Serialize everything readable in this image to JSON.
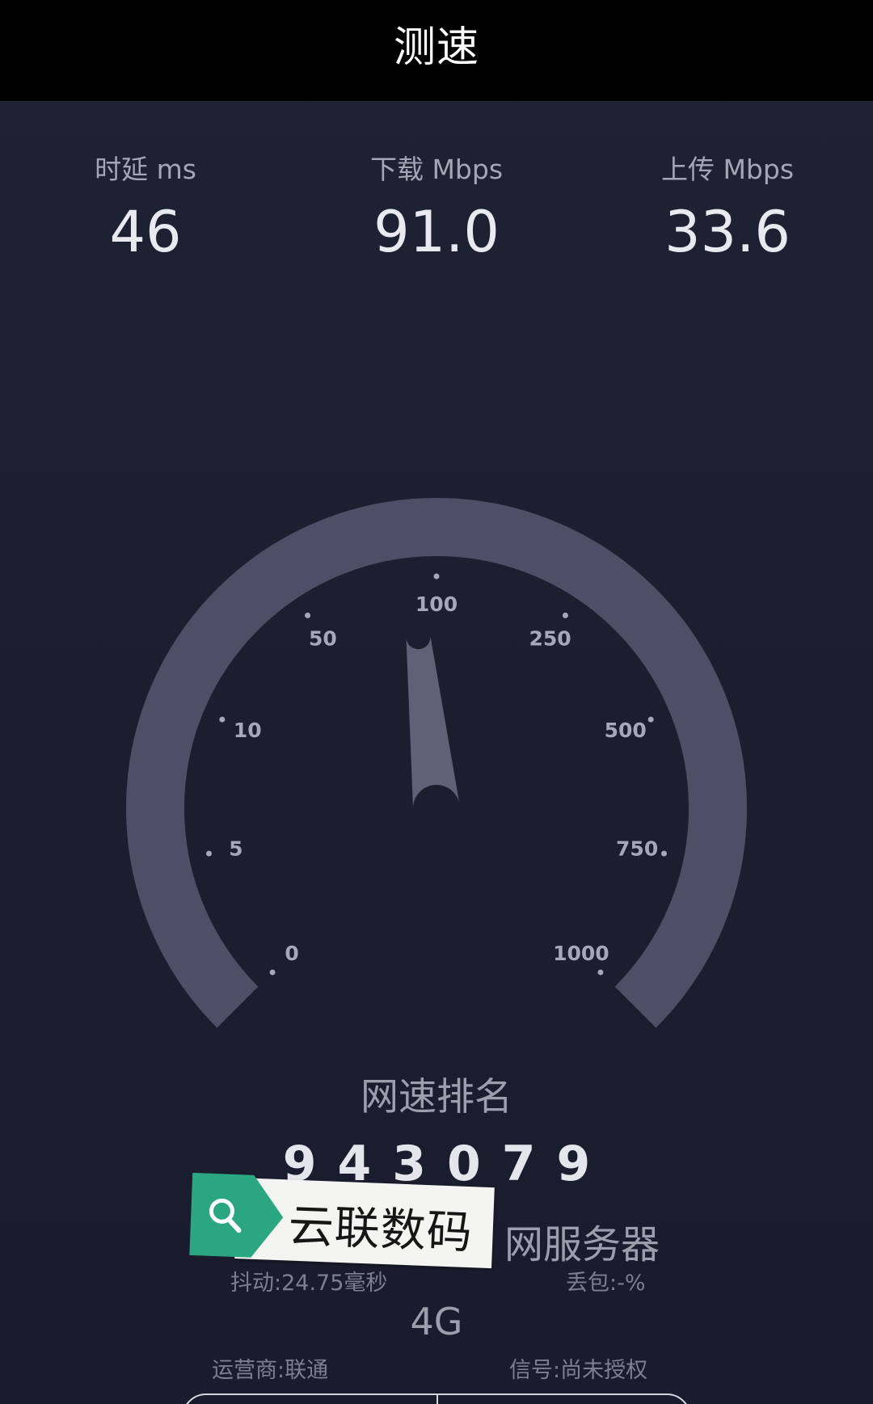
{
  "header": {
    "title": "测速"
  },
  "metrics": {
    "latency": {
      "label": "时延 ms",
      "value": "46"
    },
    "download": {
      "label": "下载 Mbps",
      "value": "91.0"
    },
    "upload": {
      "label": "上传 Mbps",
      "value": "33.6"
    }
  },
  "gauge": {
    "scale_labels": [
      "0",
      "5",
      "10",
      "50",
      "100",
      "250",
      "500",
      "750",
      "1000"
    ],
    "current_speed_mbps": 91.0,
    "arc_color": "#4c4f66",
    "needle_color": "#5f6276",
    "tick_color": "#a6a8b7"
  },
  "rank": {
    "title": "网速排名",
    "value": "943079"
  },
  "details": {
    "server_partial": "网服务器",
    "jitter": "抖动:24.75毫秒",
    "packet_loss": "丢包:-%",
    "network_type": "4G",
    "carrier": "运营商:联通",
    "signal": "信号:尚未授权"
  },
  "watermark": {
    "text": "云联数码",
    "icon": "search-icon",
    "tag_color": "#2aa781"
  }
}
